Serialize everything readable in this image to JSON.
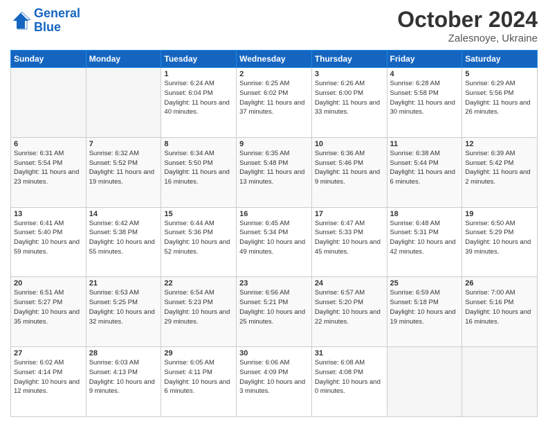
{
  "header": {
    "logo_line1": "General",
    "logo_line2": "Blue",
    "month_title": "October 2024",
    "location": "Zalesnoye, Ukraine"
  },
  "weekdays": [
    "Sunday",
    "Monday",
    "Tuesday",
    "Wednesday",
    "Thursday",
    "Friday",
    "Saturday"
  ],
  "weeks": [
    [
      {
        "day": "",
        "info": ""
      },
      {
        "day": "",
        "info": ""
      },
      {
        "day": "1",
        "info": "Sunrise: 6:24 AM\nSunset: 6:04 PM\nDaylight: 11 hours and 40 minutes."
      },
      {
        "day": "2",
        "info": "Sunrise: 6:25 AM\nSunset: 6:02 PM\nDaylight: 11 hours and 37 minutes."
      },
      {
        "day": "3",
        "info": "Sunrise: 6:26 AM\nSunset: 6:00 PM\nDaylight: 11 hours and 33 minutes."
      },
      {
        "day": "4",
        "info": "Sunrise: 6:28 AM\nSunset: 5:58 PM\nDaylight: 11 hours and 30 minutes."
      },
      {
        "day": "5",
        "info": "Sunrise: 6:29 AM\nSunset: 5:56 PM\nDaylight: 11 hours and 26 minutes."
      }
    ],
    [
      {
        "day": "6",
        "info": "Sunrise: 6:31 AM\nSunset: 5:54 PM\nDaylight: 11 hours and 23 minutes."
      },
      {
        "day": "7",
        "info": "Sunrise: 6:32 AM\nSunset: 5:52 PM\nDaylight: 11 hours and 19 minutes."
      },
      {
        "day": "8",
        "info": "Sunrise: 6:34 AM\nSunset: 5:50 PM\nDaylight: 11 hours and 16 minutes."
      },
      {
        "day": "9",
        "info": "Sunrise: 6:35 AM\nSunset: 5:48 PM\nDaylight: 11 hours and 13 minutes."
      },
      {
        "day": "10",
        "info": "Sunrise: 6:36 AM\nSunset: 5:46 PM\nDaylight: 11 hours and 9 minutes."
      },
      {
        "day": "11",
        "info": "Sunrise: 6:38 AM\nSunset: 5:44 PM\nDaylight: 11 hours and 6 minutes."
      },
      {
        "day": "12",
        "info": "Sunrise: 6:39 AM\nSunset: 5:42 PM\nDaylight: 11 hours and 2 minutes."
      }
    ],
    [
      {
        "day": "13",
        "info": "Sunrise: 6:41 AM\nSunset: 5:40 PM\nDaylight: 10 hours and 59 minutes."
      },
      {
        "day": "14",
        "info": "Sunrise: 6:42 AM\nSunset: 5:38 PM\nDaylight: 10 hours and 55 minutes."
      },
      {
        "day": "15",
        "info": "Sunrise: 6:44 AM\nSunset: 5:36 PM\nDaylight: 10 hours and 52 minutes."
      },
      {
        "day": "16",
        "info": "Sunrise: 6:45 AM\nSunset: 5:34 PM\nDaylight: 10 hours and 49 minutes."
      },
      {
        "day": "17",
        "info": "Sunrise: 6:47 AM\nSunset: 5:33 PM\nDaylight: 10 hours and 45 minutes."
      },
      {
        "day": "18",
        "info": "Sunrise: 6:48 AM\nSunset: 5:31 PM\nDaylight: 10 hours and 42 minutes."
      },
      {
        "day": "19",
        "info": "Sunrise: 6:50 AM\nSunset: 5:29 PM\nDaylight: 10 hours and 39 minutes."
      }
    ],
    [
      {
        "day": "20",
        "info": "Sunrise: 6:51 AM\nSunset: 5:27 PM\nDaylight: 10 hours and 35 minutes."
      },
      {
        "day": "21",
        "info": "Sunrise: 6:53 AM\nSunset: 5:25 PM\nDaylight: 10 hours and 32 minutes."
      },
      {
        "day": "22",
        "info": "Sunrise: 6:54 AM\nSunset: 5:23 PM\nDaylight: 10 hours and 29 minutes."
      },
      {
        "day": "23",
        "info": "Sunrise: 6:56 AM\nSunset: 5:21 PM\nDaylight: 10 hours and 25 minutes."
      },
      {
        "day": "24",
        "info": "Sunrise: 6:57 AM\nSunset: 5:20 PM\nDaylight: 10 hours and 22 minutes."
      },
      {
        "day": "25",
        "info": "Sunrise: 6:59 AM\nSunset: 5:18 PM\nDaylight: 10 hours and 19 minutes."
      },
      {
        "day": "26",
        "info": "Sunrise: 7:00 AM\nSunset: 5:16 PM\nDaylight: 10 hours and 16 minutes."
      }
    ],
    [
      {
        "day": "27",
        "info": "Sunrise: 6:02 AM\nSunset: 4:14 PM\nDaylight: 10 hours and 12 minutes."
      },
      {
        "day": "28",
        "info": "Sunrise: 6:03 AM\nSunset: 4:13 PM\nDaylight: 10 hours and 9 minutes."
      },
      {
        "day": "29",
        "info": "Sunrise: 6:05 AM\nSunset: 4:11 PM\nDaylight: 10 hours and 6 minutes."
      },
      {
        "day": "30",
        "info": "Sunrise: 6:06 AM\nSunset: 4:09 PM\nDaylight: 10 hours and 3 minutes."
      },
      {
        "day": "31",
        "info": "Sunrise: 6:08 AM\nSunset: 4:08 PM\nDaylight: 10 hours and 0 minutes."
      },
      {
        "day": "",
        "info": ""
      },
      {
        "day": "",
        "info": ""
      }
    ]
  ]
}
